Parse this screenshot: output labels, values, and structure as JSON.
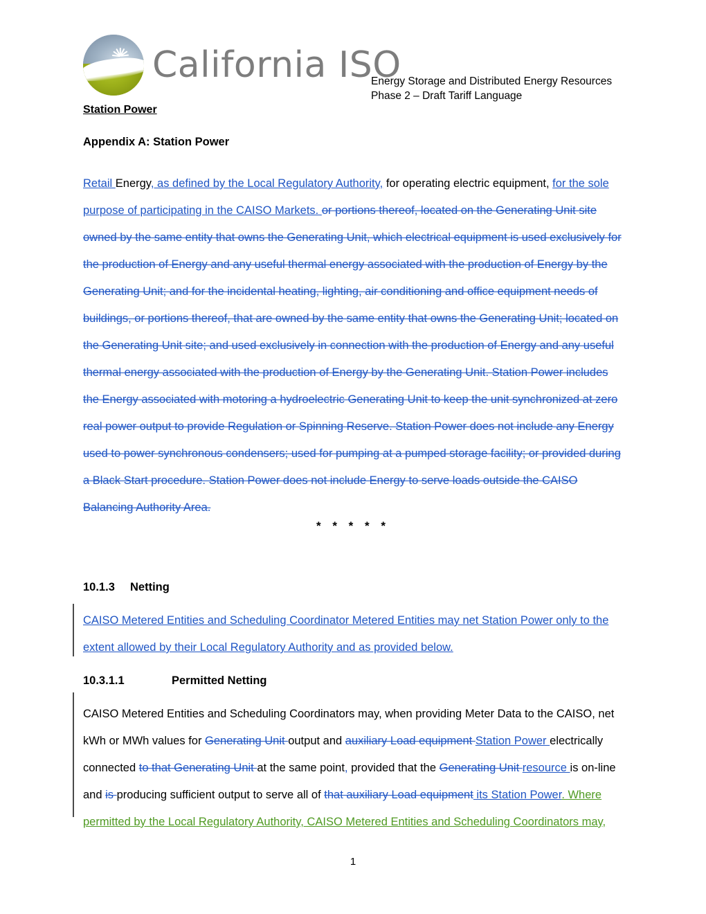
{
  "document": {
    "header_right_line1": "Energy Storage and Distributed Energy Resources",
    "header_right_line2": "Phase 2 – Draft Tariff Language",
    "logo_wordmark": "California ISO",
    "page_number": "1",
    "separator": "* * * * *"
  },
  "colors": {
    "insert_author_1": "#1f55c4",
    "insert_author_2": "#4f9a22",
    "delete_author_1": "#1f55c4",
    "wordmark_gray": "#7d7d7d",
    "changebar": "#4a4a4a"
  },
  "section_station_power": {
    "title": "Station Power",
    "appendix_heading": "Appendix A: Station Power",
    "definition": {
      "run_1_ins": "Retail ",
      "run_2_plain": "Energy",
      "run_3_ins": ", as defined by the Local Regulatory Authority,",
      "run_4_plain": " for operating electric equipment, ",
      "run_5_ins": "for the sole purpose of participating in the CAISO Markets. ",
      "run_6_del": "or portions thereof, located on the Generating Unit site owned by the same entity that owns the Generating Unit, which electrical equipment is used exclusively for the production of Energy and any useful thermal energy associated with the production of Energy by the Generating Unit; and for the incidental heating, lighting, air conditioning and office equipment needs of buildings, or portions thereof, that are owned by the same entity that owns the Generating Unit; located on the Generating Unit site; and used exclusively in connection with the production of Energy and any useful thermal energy associated with the production of Energy by the Generating Unit.  Station Power includes the Energy associated with motoring a hydroelectric Generating Unit to keep the unit synchronized at zero real power output to provide Regulation or Spinning Reserve.  Station Power does not include any Energy used to power synchronous condensers; used for pumping at a pumped storage facility; or provided during a Black Start procedure.  Station Power does not include Energy to serve loads outside the CAISO Balancing Authority Area."
    }
  },
  "section_netting": {
    "heading_number": "10.1.3",
    "heading_title": "Netting",
    "body_ins": "CAISO Metered Entities and Scheduling Coordinator Metered Entities may net Station Power only to the extent allowed by their Local Regulatory Authority and as provided below. "
  },
  "section_permitted_netting": {
    "heading_number": "10.3.1.1",
    "heading_title": "Permitted Netting",
    "runs": [
      {
        "type": "plain",
        "text": "CAISO Metered Entities and Scheduling Coordinators may, when providing Meter Data to the CAISO, net kWh or MWh values for "
      },
      {
        "type": "del",
        "text": "Generating Unit "
      },
      {
        "type": "plain",
        "text": "output and "
      },
      {
        "type": "del",
        "text": "auxiliary Load equipment "
      },
      {
        "type": "ins",
        "text": "Station Power "
      },
      {
        "type": "plain",
        "text": "electrically connected "
      },
      {
        "type": "del",
        "text": "to that Generating Unit "
      },
      {
        "type": "plain",
        "text": "at the same point"
      },
      {
        "type": "ins",
        "text": ","
      },
      {
        "type": "plain",
        "text": " provided that the "
      },
      {
        "type": "del",
        "text": "Generating Unit "
      },
      {
        "type": "ins",
        "text": "resource "
      },
      {
        "type": "plain",
        "text": "is on-line and "
      },
      {
        "type": "del",
        "text": "is "
      },
      {
        "type": "plain",
        "text": "producing sufficient output to serve all of "
      },
      {
        "type": "del",
        "text": "that auxiliary Load equipment"
      },
      {
        "type": "ins",
        "text": " its Station Power"
      },
      {
        "type": "ins2",
        "text": ".  Where permitted by the Local Regulatory Authority, CAISO Metered Entities and Scheduling Coordinators may, "
      }
    ]
  }
}
